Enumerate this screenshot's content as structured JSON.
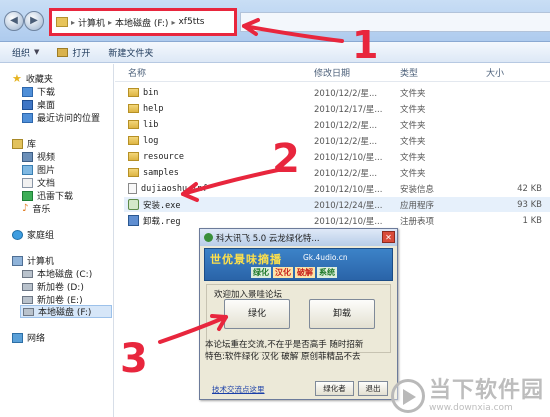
{
  "address_bar": {
    "crumbs": [
      "计算机",
      "本地磁盘 (F:)",
      "xf5tts"
    ]
  },
  "toolbar": {
    "organize": "组织",
    "open": "打开",
    "new_folder": "新建文件夹"
  },
  "nav": {
    "favorites": "收藏夹",
    "downloads": "下载",
    "desktop": "桌面",
    "recent": "最近访问的位置",
    "libraries": "库",
    "videos": "视频",
    "pictures": "图片",
    "documents": "文档",
    "xunlei": "迅雷下载",
    "music": "音乐",
    "homegroup": "家庭组",
    "computer": "计算机",
    "drive_c": "本地磁盘 (C:)",
    "drive_d": "新加卷 (D:)",
    "drive_e": "新加卷 (E:)",
    "drive_f": "本地磁盘 (F:)",
    "network": "网络"
  },
  "columns": {
    "name": "名称",
    "modified": "修改日期",
    "type": "类型",
    "size": "大小"
  },
  "files": [
    {
      "name": "bin",
      "date": "2010/12/2/星...",
      "type": "文件夹",
      "size": ""
    },
    {
      "name": "help",
      "date": "2010/12/17/星...",
      "type": "文件夹",
      "size": ""
    },
    {
      "name": "lib",
      "date": "2010/12/2/星...",
      "type": "文件夹",
      "size": ""
    },
    {
      "name": "log",
      "date": "2010/12/2/星...",
      "type": "文件夹",
      "size": ""
    },
    {
      "name": "resource",
      "date": "2010/12/10/星...",
      "type": "文件夹",
      "size": ""
    },
    {
      "name": "samples",
      "date": "2010/12/2/星...",
      "type": "文件夹",
      "size": ""
    },
    {
      "name": "dujiaoshu.inf",
      "date": "2010/12/10/星...",
      "type": "安装信息",
      "size": "42 KB"
    },
    {
      "name": "安装.exe",
      "date": "2010/12/24/星...",
      "type": "应用程序",
      "size": "93 KB"
    },
    {
      "name": "卸载.reg",
      "date": "2010/12/10/星...",
      "type": "注册表项",
      "size": "1 KB"
    }
  ],
  "dialog": {
    "title": "科大讯飞 5.0 云龙绿化特...",
    "banner_title": "世优景味摘播",
    "banner_url": "Gk.4udio.cn",
    "banner_tags": [
      "绿化",
      "汉化",
      "破解",
      "系统"
    ],
    "group_label": "欢迎加入景哇论坛",
    "btn_green": "绿化",
    "btn_uninstall": "卸载",
    "desc_line1": "本论坛重在交流,不在乎是否高手  随时招新",
    "desc_line2": "特色:软件绿化 汉化 破解 原创菲精品不去",
    "footer_link": "技术交流点这里",
    "footer_btn": "绿化者",
    "footer_exit": "退出"
  },
  "annotations": {
    "n1": "1",
    "n2": "2",
    "n3": "3",
    "color": "#e8263d"
  },
  "watermark": {
    "name": "当下软件园",
    "url": "www.downxia.com"
  }
}
